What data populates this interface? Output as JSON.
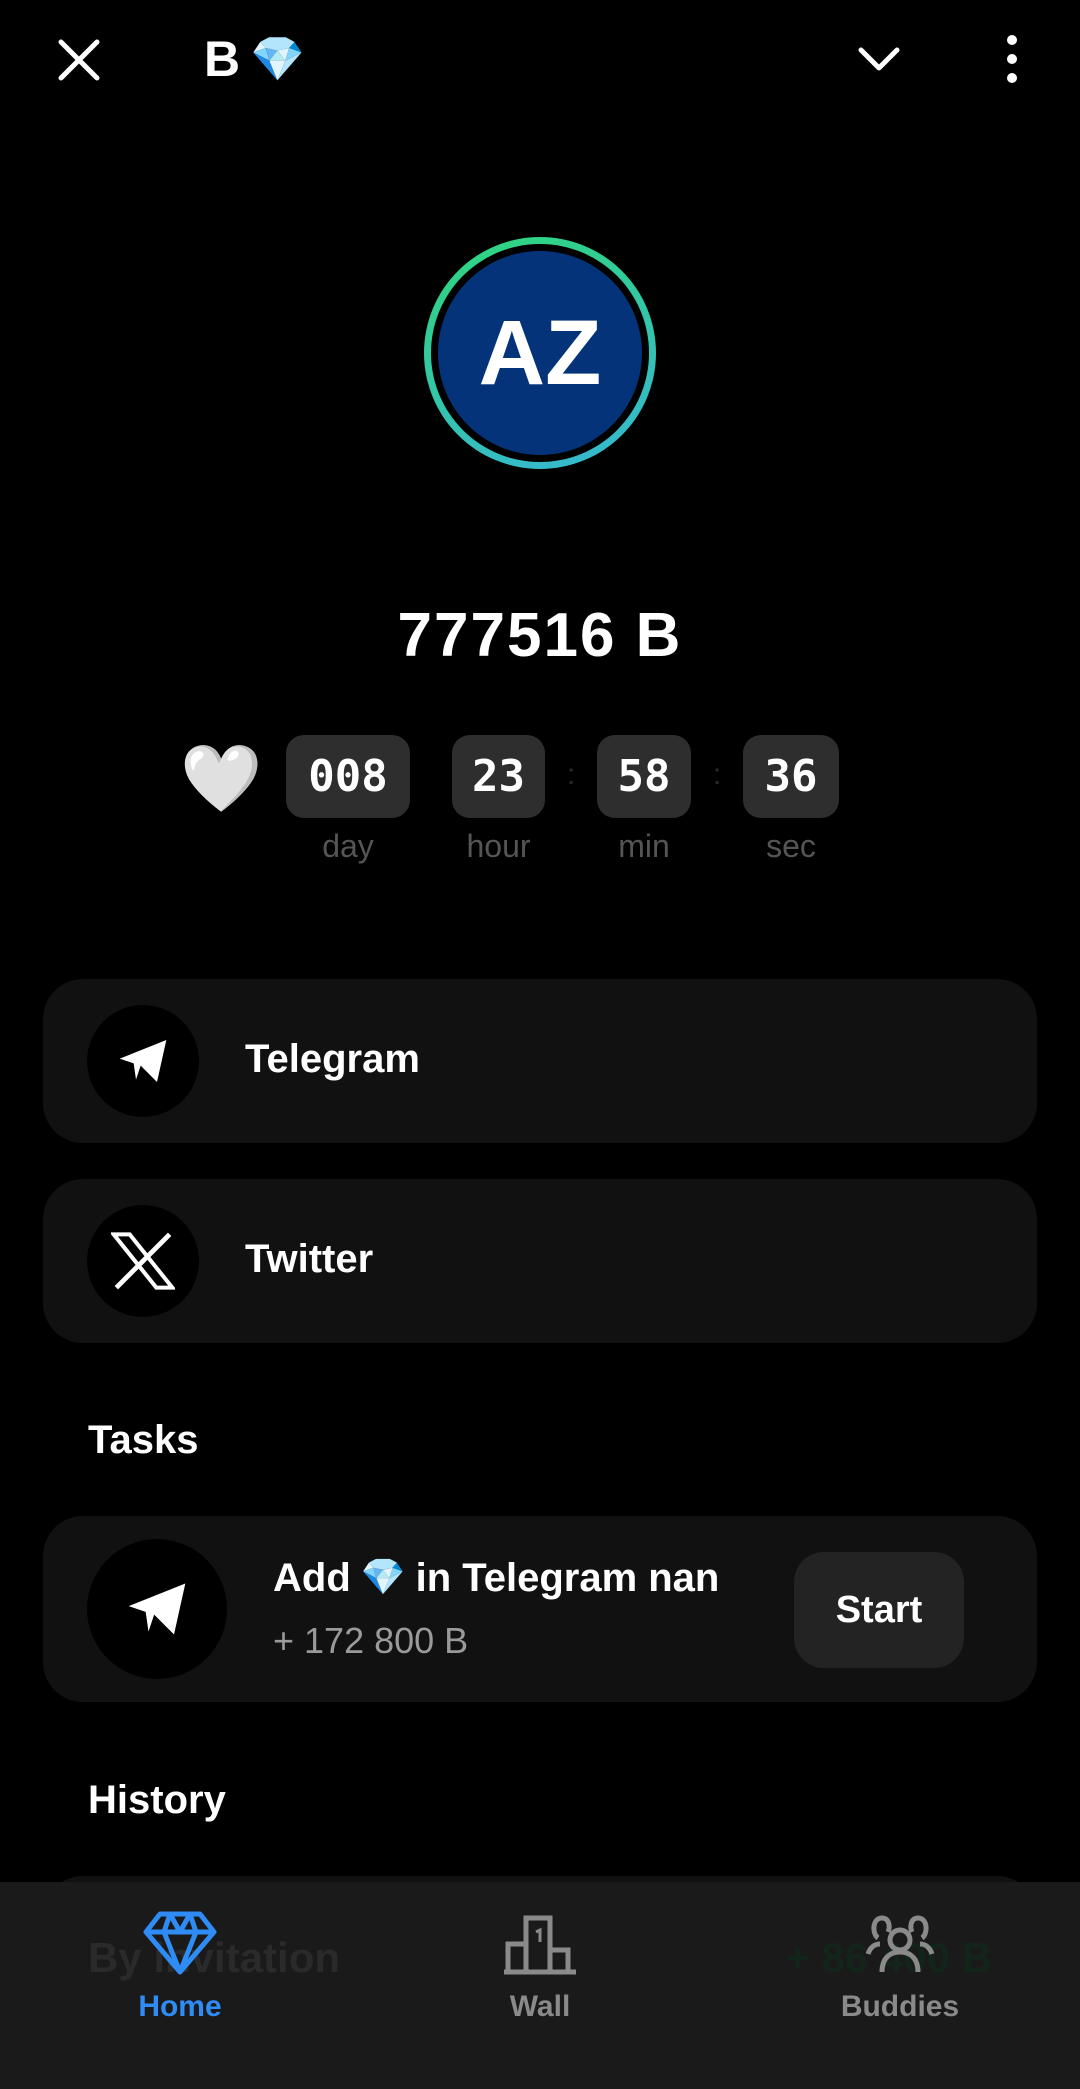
{
  "topbar": {
    "close_icon": "close-icon",
    "title": "B",
    "title_emoji": "💎",
    "chevron_icon": "chevron-down-icon",
    "menu_icon": "more-vertical-icon"
  },
  "profile": {
    "initials": "AZ",
    "balance": "777516 B",
    "ring_colors": [
      "#2fd67a",
      "#36b6d6"
    ],
    "avatar_bg": "#04337a"
  },
  "timer": {
    "heart": "🤍",
    "days": "008",
    "hours": "23",
    "minutes": "58",
    "seconds": "36",
    "day_label": "day",
    "hour_label": "hour",
    "min_label": "min",
    "sec_label": "sec"
  },
  "socials": [
    {
      "label": "Telegram",
      "icon": "telegram-icon"
    },
    {
      "label": "Twitter",
      "icon": "x-icon"
    }
  ],
  "tasks": {
    "heading": "Tasks",
    "items": [
      {
        "title_pre": "Add",
        "emoji": "💎",
        "title_post": "in Telegram nan",
        "reward": "+ 172 800 B",
        "button": "Start"
      }
    ]
  },
  "history": {
    "heading": "History",
    "items": [
      {
        "label": "By invitation",
        "amount": "+ 86 400 B"
      }
    ]
  },
  "nav": {
    "active_color": "#2f8cf5",
    "items": [
      {
        "label": "Home",
        "icon": "diamond-icon"
      },
      {
        "label": "Wall",
        "icon": "podium-icon"
      },
      {
        "label": "Buddies",
        "icon": "users-icon"
      }
    ]
  }
}
